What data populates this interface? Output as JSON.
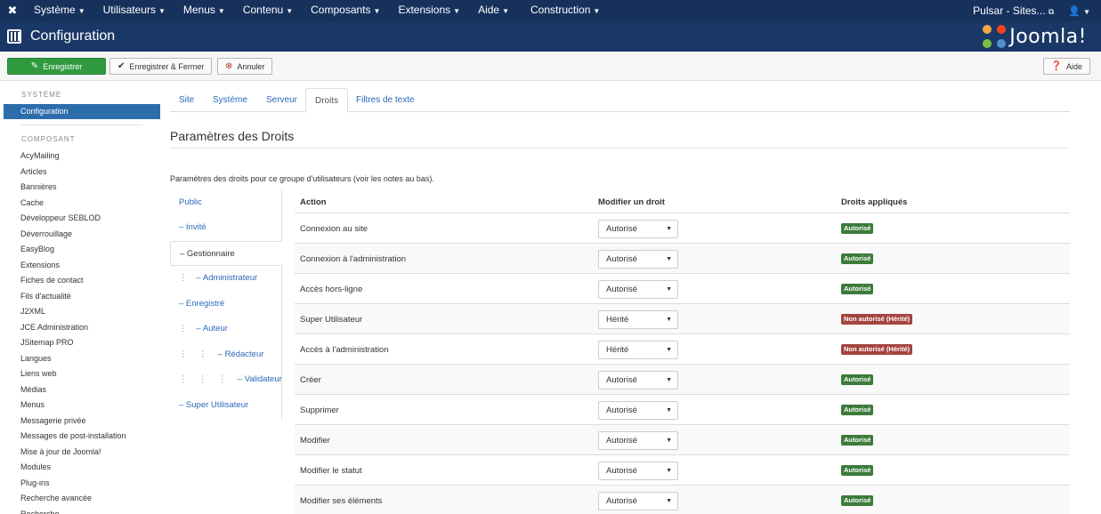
{
  "topnav": {
    "menus": [
      "Système",
      "Utilisateurs",
      "Menus",
      "Contenu",
      "Composants",
      "Extensions",
      "Aide",
      "Construction"
    ],
    "site_link": "Pulsar - Sites...",
    "caret": "▼"
  },
  "header": {
    "title": "Configuration",
    "brand": "Joomla!"
  },
  "toolbar": {
    "save": "Enregistrer",
    "save_close": "Enregistrer & Fermer",
    "cancel": "Annuler",
    "help": "Aide"
  },
  "sidebar": {
    "system_heading": "SYSTÈME",
    "active_item": "Configuration",
    "component_heading": "COMPOSANT",
    "items": [
      "AcyMailing",
      "Articles",
      "Bannières",
      "Cache",
      "Développeur SEBLOD",
      "Déverrouillage",
      "EasyBlog",
      "Extensions",
      "Fiches de contact",
      "Fils d'actualité",
      "J2XML",
      "JCE Administration",
      "JSitemap PRO",
      "Langues",
      "Liens web",
      "Médias",
      "Menus",
      "Messagerie privée",
      "Messages de post-installation",
      "Mise à jour de Joomla!",
      "Modules",
      "Plug-ins",
      "Recherche avancée",
      "Recherche"
    ]
  },
  "tabs": [
    "Site",
    "Système",
    "Serveur",
    "Droits",
    "Filtres de texte"
  ],
  "main": {
    "title": "Paramètres des Droits",
    "description": "Paramètres des droits pour ce groupe d'utilisateurs (voir les notes au bas)."
  },
  "groups": [
    {
      "label": "Public",
      "prefix": ""
    },
    {
      "label": "– Invité",
      "prefix": ""
    },
    {
      "label": "– Gestionnaire",
      "prefix": ""
    },
    {
      "label": "– Administrateur",
      "prefix": "⋮"
    },
    {
      "label": "– Enregistré",
      "prefix": ""
    },
    {
      "label": "– Auteur",
      "prefix": "⋮"
    },
    {
      "label": "– Rédacteur",
      "prefix": "⋮ ⋮"
    },
    {
      "label": "– Validateur",
      "prefix": "⋮ ⋮ ⋮"
    },
    {
      "label": "– Super Utilisateur",
      "prefix": ""
    }
  ],
  "permissions": {
    "headers": {
      "action": "Action",
      "modify": "Modifier un droit",
      "applied": "Droits appliqués"
    },
    "rows": [
      {
        "action": "Connexion au site",
        "select": "Autorisé",
        "applied": "Autorisé",
        "status": "ok"
      },
      {
        "action": "Connexion à l'administration",
        "select": "Autorisé",
        "applied": "Autorisé",
        "status": "ok"
      },
      {
        "action": "Accès hors-ligne",
        "select": "Autorisé",
        "applied": "Autorisé",
        "status": "ok"
      },
      {
        "action": "Super Utilisateur",
        "select": "Hérité",
        "applied": "Non autorisé (Hérité)",
        "status": "no"
      },
      {
        "action": "Accès à l'administration",
        "select": "Hérité",
        "applied": "Non autorisé (Hérité)",
        "status": "no"
      },
      {
        "action": "Créer",
        "select": "Autorisé",
        "applied": "Autorisé",
        "status": "ok"
      },
      {
        "action": "Supprimer",
        "select": "Autorisé",
        "applied": "Autorisé",
        "status": "ok"
      },
      {
        "action": "Modifier",
        "select": "Autorisé",
        "applied": "Autorisé",
        "status": "ok"
      },
      {
        "action": "Modifier le statut",
        "select": "Autorisé",
        "applied": "Autorisé",
        "status": "ok"
      },
      {
        "action": "Modifier ses éléments",
        "select": "Autorisé",
        "applied": "Autorisé",
        "status": "ok"
      }
    ]
  },
  "colors": {
    "navbar": "#17315d",
    "header": "#1a3867",
    "save_button": "#2f9a3e",
    "active_blue": "#2d6dac",
    "badge_ok": "#3c7b3a",
    "badge_no": "#a4443f"
  }
}
